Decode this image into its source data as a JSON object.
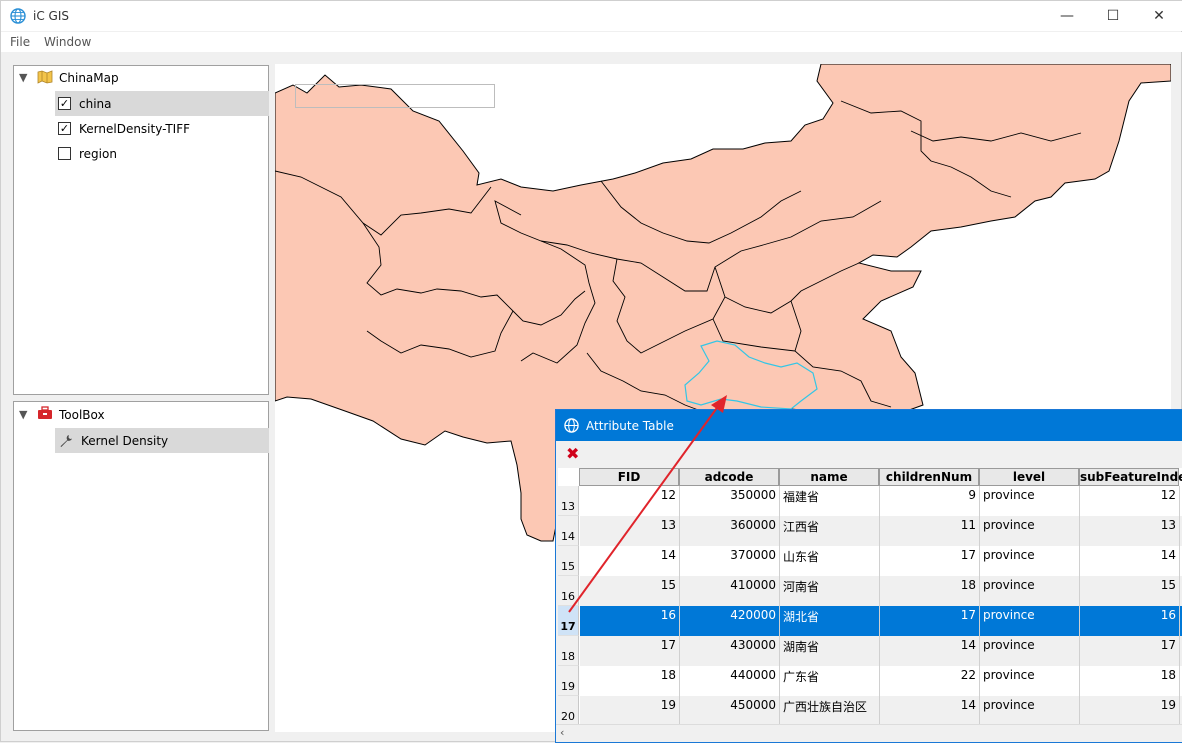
{
  "app": {
    "title": "iC GIS",
    "minimize": "—",
    "maximize": "☐",
    "close": "✕"
  },
  "menu": [
    "File",
    "Window"
  ],
  "layers": {
    "root": "ChinaMap",
    "items": [
      {
        "label": "china",
        "checked": true,
        "check": "✓"
      },
      {
        "label": "KernelDensity-TIFF",
        "checked": true,
        "check": "✓"
      },
      {
        "label": "region",
        "checked": false,
        "check": ""
      }
    ]
  },
  "toolbox": {
    "root": "ToolBox",
    "items": [
      {
        "label": "Kernel Density"
      }
    ]
  },
  "attribute_table": {
    "title": "Attribute Table",
    "columns": [
      "FID",
      "adcode",
      "name",
      "childrenNum",
      "level",
      "subFeatureIndex"
    ],
    "rows": [
      {
        "index": "13",
        "fid": "12",
        "adcode": "350000",
        "name": "福建省",
        "children": "9",
        "level": "province",
        "sub": "12"
      },
      {
        "index": "14",
        "fid": "13",
        "adcode": "360000",
        "name": "江西省",
        "children": "11",
        "level": "province",
        "sub": "13"
      },
      {
        "index": "15",
        "fid": "14",
        "adcode": "370000",
        "name": "山东省",
        "children": "17",
        "level": "province",
        "sub": "14"
      },
      {
        "index": "16",
        "fid": "15",
        "adcode": "410000",
        "name": "河南省",
        "children": "18",
        "level": "province",
        "sub": "15"
      },
      {
        "index": "17",
        "fid": "16",
        "adcode": "420000",
        "name": "湖北省",
        "children": "17",
        "level": "province",
        "sub": "16"
      },
      {
        "index": "18",
        "fid": "17",
        "adcode": "430000",
        "name": "湖南省",
        "children": "14",
        "level": "province",
        "sub": "17"
      },
      {
        "index": "19",
        "fid": "18",
        "adcode": "440000",
        "name": "广东省",
        "children": "22",
        "level": "province",
        "sub": "18"
      },
      {
        "index": "20",
        "fid": "19",
        "adcode": "450000",
        "name": "广西壮族自治区",
        "children": "14",
        "level": "province",
        "sub": "19"
      }
    ],
    "selected_index": "17"
  },
  "colors": {
    "map_fill": "#fcc8b4",
    "selected_row": "#0078d7",
    "highlight_outline": "#33c6e6",
    "arrow": "#e0242b"
  }
}
